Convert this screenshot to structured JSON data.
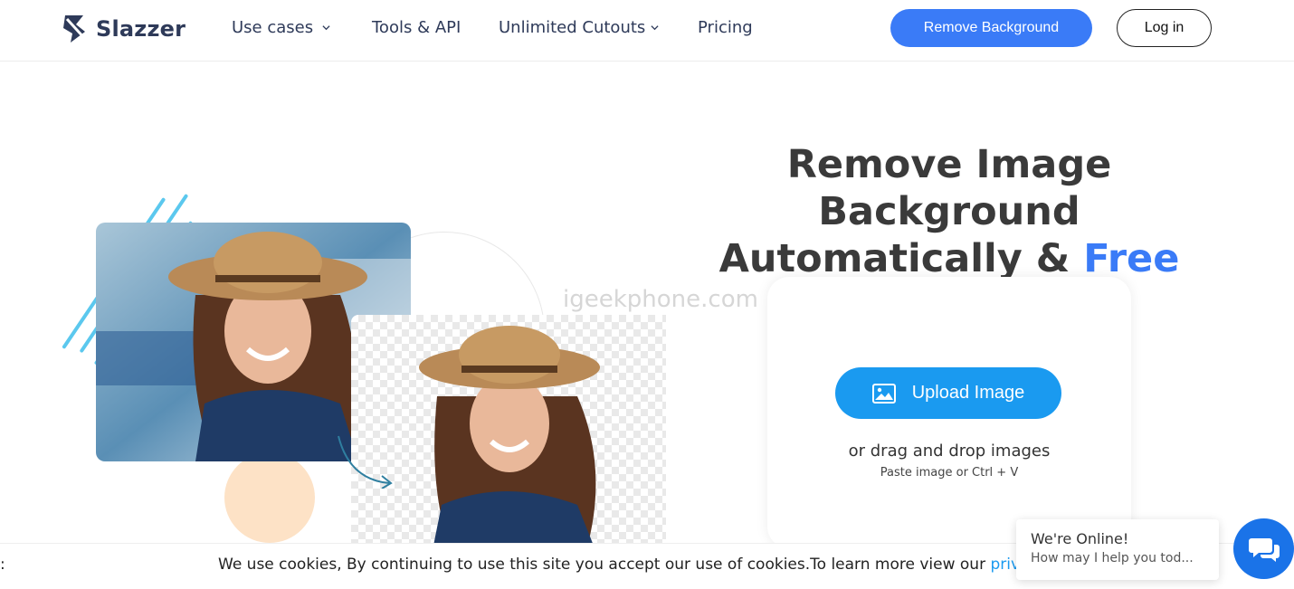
{
  "brand": {
    "name": "Slazzer",
    "logo_icon": "slazzer-logo-icon"
  },
  "nav": {
    "items": [
      {
        "label": "Use cases",
        "has_dropdown": true
      },
      {
        "label": "Tools & API",
        "has_dropdown": false
      },
      {
        "label": "Unlimited Cutouts",
        "has_dropdown": true
      },
      {
        "label": "Pricing",
        "has_dropdown": false
      }
    ],
    "cta_label": "Remove Background",
    "login_label": "Log in"
  },
  "hero": {
    "headline_line1": "Remove Image Background",
    "headline_line2": "Automatically & ",
    "headline_highlight": "Free",
    "watermark": "igeekphone.com"
  },
  "upload": {
    "button_label": "Upload Image",
    "button_icon": "image-icon",
    "drag_text": "or drag and drop images",
    "paste_text": "Paste image or Ctrl + V"
  },
  "cookie": {
    "edge_char": ":",
    "text": "We use cookies, By continuing to use this site you accept our use of cookies.To learn more view our ",
    "link_text": "priva"
  },
  "chat": {
    "title": "We're Online!",
    "subtitle": "How may I help you tod...",
    "icon": "chat-icon"
  },
  "colors": {
    "accent_blue": "#3a7bf7",
    "upload_blue": "#1a9af0",
    "chat_blue": "#1a73e8",
    "stripe_cyan": "#5bc8ee",
    "peach": "#fde2c6"
  }
}
